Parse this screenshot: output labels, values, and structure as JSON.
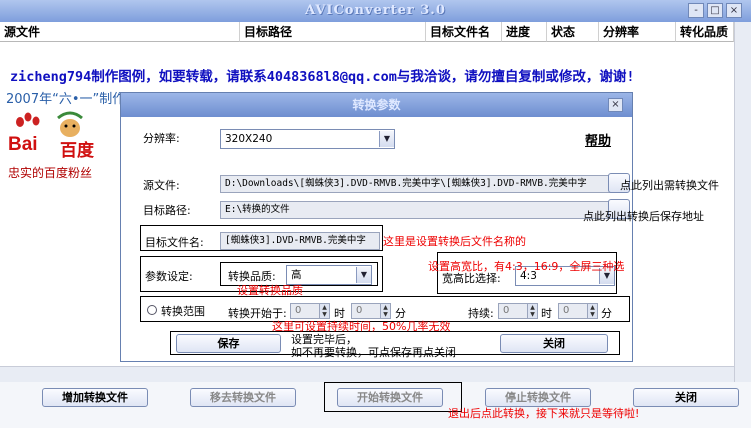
{
  "window": {
    "title": "AVIConverter 3.0",
    "min": "-",
    "max": "□",
    "close": "×"
  },
  "columns": [
    "源文件",
    "目标路径",
    "目标文件名",
    "进度",
    "状态",
    "分辨率",
    "转化品质"
  ],
  "notice": "zicheng794制作图例，如要转载，请联系4048368l8@qq.com与我洽谈，请勿擅自复制或修改，谢谢!",
  "watermark": {
    "date": "2007年“六•一”制作",
    "logo_text": "Bai",
    "logo_cn": "百度",
    "caption": "忠实的百度粉丝"
  },
  "dialog": {
    "title": "转换参数",
    "resolution_label": "分辨率:",
    "resolution_value": "320X240",
    "help": "帮助",
    "source_label": "源文件:",
    "source_value": "D:\\Downloads\\[蜘蛛侠3].DVD-RMVB.完美中字\\[蜘蛛侠3].DVD-RMVB.完美中字",
    "target_path_label": "目标路径:",
    "target_path_value": "E:\\转换的文件",
    "target_name_label": "目标文件名:",
    "target_name_value": "[蜘蛛侠3].DVD-RMVB.完美中字",
    "params_label": "参数设定:",
    "quality_label": "转换品质:",
    "quality_value": "高",
    "aspect_label": "宽高比选择:",
    "aspect_value": "4:3",
    "range_label": "转换范围",
    "start_label": "转换开始于:",
    "duration_label": "持续:",
    "hour": "时",
    "minute": "分",
    "spin_value": "0",
    "save": "保存",
    "close": "关闭",
    "close_icon": "×"
  },
  "annotations": {
    "source": "点此列出需转换文件",
    "target_path": "点此列出转换后保存地址",
    "target_name": "这里是设置转换后文件名称的",
    "aspect": "设置高宽比，有4:3，16:9，全屏三种选",
    "quality": "设置转换品质",
    "range": "这里可设置持续时间，50%几率无效",
    "after_save_1": "设置完毕后，",
    "after_save_2": "如不再要转换，可点保存再点关闭",
    "bottom": "退出后点此转换，接下来就只是等待啦!"
  },
  "toolbar": {
    "add": "增加转换文件",
    "remove": "移去转换文件",
    "start": "开始转换文件",
    "stop": "停止转换文件",
    "close": "关闭"
  }
}
